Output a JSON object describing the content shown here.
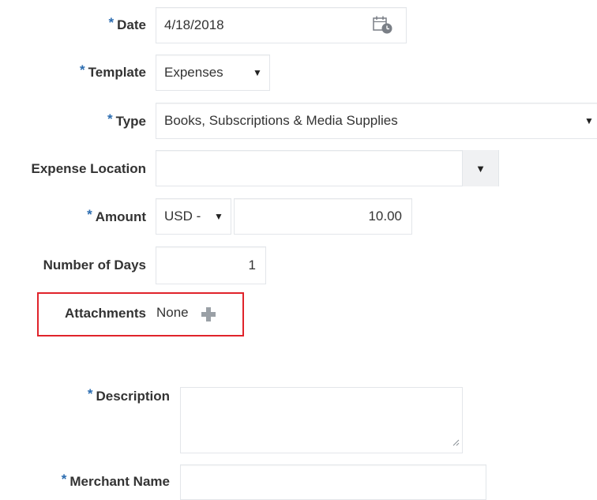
{
  "form": {
    "date": {
      "label": "Date",
      "required": "*",
      "value": "4/18/2018"
    },
    "template": {
      "label": "Template",
      "required": "*",
      "value": "Expenses"
    },
    "type": {
      "label": "Type",
      "required": "*",
      "value": "Books, Subscriptions & Media Supplies"
    },
    "expense_location": {
      "label": "Expense Location",
      "value": ""
    },
    "amount": {
      "label": "Amount",
      "required": "*",
      "currency": "USD -",
      "value": "10.00"
    },
    "number_of_days": {
      "label": "Number of Days",
      "value": "1"
    },
    "attachments": {
      "label": "Attachments",
      "value": "None"
    },
    "description": {
      "label": "Description",
      "required": "*",
      "value": ""
    },
    "merchant_name": {
      "label": "Merchant Name",
      "required": "*",
      "value": ""
    }
  },
  "icons": {
    "date_picker": "calendar-icon",
    "dropdown": "caret-down-icon",
    "add_attachment": "plus-icon",
    "resize": "resize-grip-icon"
  },
  "colors": {
    "required_asterisk": "#2b6cb0",
    "highlight_border": "#e0232b",
    "label_text": "#333333",
    "field_border": "#e3e6ea"
  }
}
